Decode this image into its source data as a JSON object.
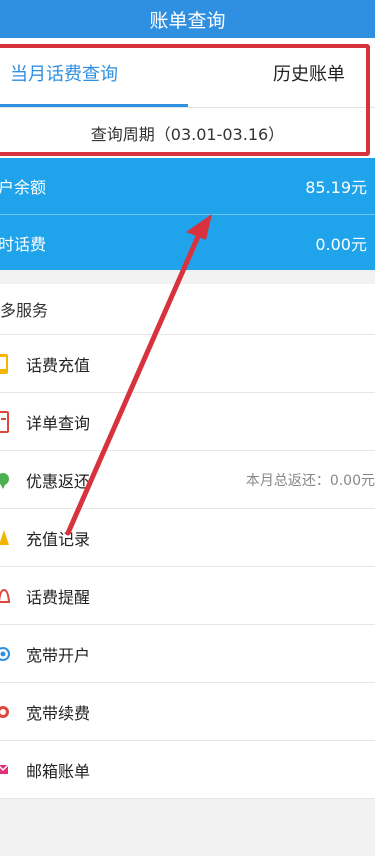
{
  "header": {
    "title": "账单查询"
  },
  "tabs": [
    {
      "label": "当月话费查询",
      "active": true
    },
    {
      "label": "历史账单",
      "active": false
    }
  ],
  "period": {
    "text": "查询周期（03.01-03.16）"
  },
  "balance_rows": [
    {
      "label": "户余额",
      "value": "85.19元"
    },
    {
      "label": "时话费",
      "value": "0.00元"
    }
  ],
  "services": {
    "title": "多服务",
    "items": [
      {
        "label": "话费充值",
        "icon": "recharge-icon",
        "extra": ""
      },
      {
        "label": "详单查询",
        "icon": "detail-icon",
        "extra": ""
      },
      {
        "label": "优惠返还",
        "icon": "refund-icon",
        "extra": "本月总返还：0.00元"
      },
      {
        "label": "充值记录",
        "icon": "record-icon",
        "extra": ""
      },
      {
        "label": "话费提醒",
        "icon": "bell-icon",
        "extra": ""
      },
      {
        "label": "宽带开户",
        "icon": "broadband-icon",
        "extra": ""
      },
      {
        "label": "宽带续费",
        "icon": "renew-icon",
        "extra": ""
      },
      {
        "label": "邮箱账单",
        "icon": "mail-icon",
        "extra": ""
      }
    ]
  },
  "colors": {
    "header_bg": "#2f8fe0",
    "balance_bg": "#1fa3ea",
    "annotation_red": "#d8323f"
  }
}
